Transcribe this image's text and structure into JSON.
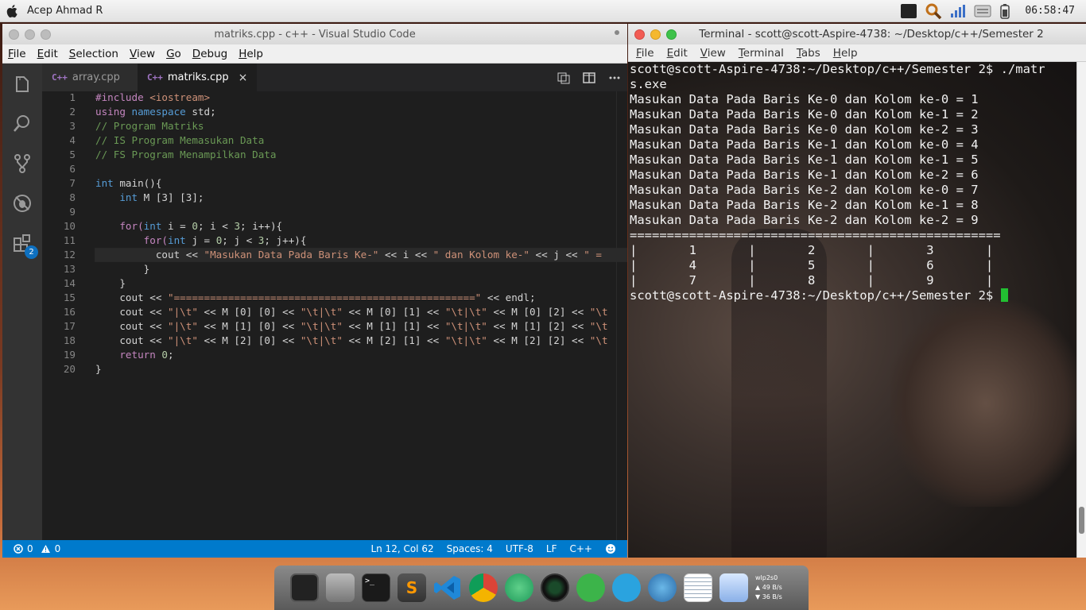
{
  "topbar": {
    "user": "Acep Ahmad R",
    "clock": "06:58:47",
    "tray_icons": [
      "terminal-icon",
      "search-icon",
      "network-monitor-icon",
      "keyboard-icon",
      "battery-icon"
    ]
  },
  "vscode": {
    "title": "matriks.cpp - c++ - Visual Studio Code",
    "menu": [
      {
        "mn": "F",
        "rest": "ile"
      },
      {
        "mn": "E",
        "rest": "dit"
      },
      {
        "mn": "S",
        "rest": "election"
      },
      {
        "mn": "V",
        "rest": "iew"
      },
      {
        "mn": "G",
        "rest": "o"
      },
      {
        "mn": "D",
        "rest": "ebug"
      },
      {
        "mn": "H",
        "rest": "elp"
      }
    ],
    "tabs": [
      {
        "lang": "C++",
        "label": "array.cpp"
      },
      {
        "lang": "C++",
        "label": "matriks.cpp"
      }
    ],
    "tab_close": "×",
    "scm_badge": "2",
    "line_numbers": [
      "1",
      "2",
      "3",
      "4",
      "5",
      "6",
      "7",
      "8",
      "9",
      "10",
      "11",
      "12",
      "13",
      "14",
      "15",
      "16",
      "17",
      "18",
      "19",
      "20"
    ],
    "status": {
      "errors": "0",
      "warnings": "0",
      "position": "Ln 12, Col 62",
      "spaces": "Spaces: 4",
      "encoding": "UTF-8",
      "eol": "LF",
      "language": "C++"
    }
  },
  "code": {
    "l1a": "#include ",
    "l1b": "<iostream>",
    "l2a": "using ",
    "l2b": "namespace ",
    "l2c": "std;",
    "l3": "// Program Matriks",
    "l4": "// IS Program Memasukan Data",
    "l5": "// FS Program Menampilkan Data",
    "l7a": "int ",
    "l7b": "main(){",
    "l8a": "    int ",
    "l8b": "M [3] [3];",
    "l10a": "    for(",
    "l10b": "int ",
    "l10c": "i = ",
    "l10d": "0",
    "l10e": "; i < ",
    "l10f": "3",
    "l10g": "; i++){",
    "l11a": "        for(",
    "l11b": "int ",
    "l11c": "j = ",
    "l11d": "0",
    "l11e": "; j < ",
    "l11f": "3",
    "l11g": "; j++){",
    "l12a": "          cout << ",
    "l12b": "\"Masukan Data Pada Baris Ke-\"",
    "l12c": " << i << ",
    "l12d": "\" dan Kolom ke-\"",
    "l12e": " << j << ",
    "l12f": "\" = ",
    "l13": "        }",
    "l14": "    }",
    "l15a": "    cout << ",
    "l15b": "\"==================================================\"",
    "l15c": " << endl;",
    "l16a": "    cout << ",
    "l16b": "\"|\\t\"",
    "l16c": " << M [0] [0] << ",
    "l16d": "\"\\t|\\t\"",
    "l16e": " << M [0] [1] << ",
    "l16f": "\"\\t|\\t\"",
    "l16g": " << M [0] [2] << ",
    "l16h": "\"\\t",
    "l17a": "    cout << ",
    "l17b": "\"|\\t\"",
    "l17c": " << M [1] [0] << ",
    "l17d": "\"\\t|\\t\"",
    "l17e": " << M [1] [1] << ",
    "l17f": "\"\\t|\\t\"",
    "l17g": " << M [1] [2] << ",
    "l17h": "\"\\t",
    "l18a": "    cout << ",
    "l18b": "\"|\\t\"",
    "l18c": " << M [2] [0] << ",
    "l18d": "\"\\t|\\t\"",
    "l18e": " << M [2] [1] << ",
    "l18f": "\"\\t|\\t\"",
    "l18g": " << M [2] [2] << ",
    "l18h": "\"\\t",
    "l19a": "    return ",
    "l19b": "0",
    "l19c": ";",
    "l20": "}"
  },
  "terminal": {
    "title": "Terminal - scott@scott-Aspire-4738: ~/Desktop/c++/Semester 2",
    "menu": [
      {
        "mn": "F",
        "rest": "ile"
      },
      {
        "mn": "E",
        "rest": "dit"
      },
      {
        "mn": "V",
        "rest": "iew"
      },
      {
        "mn": "T",
        "rest": "erminal"
      },
      {
        "mn": "T",
        "rest": "abs"
      },
      {
        "mn": "H",
        "rest": "elp"
      }
    ],
    "lines": [
      "scott@scott-Aspire-4738:~/Desktop/c++/Semester 2$ ./matr",
      "s.exe",
      "Masukan Data Pada Baris Ke-0 dan Kolom ke-0 = 1",
      "Masukan Data Pada Baris Ke-0 dan Kolom ke-1 = 2",
      "Masukan Data Pada Baris Ke-0 dan Kolom ke-2 = 3",
      "Masukan Data Pada Baris Ke-1 dan Kolom ke-0 = 4",
      "Masukan Data Pada Baris Ke-1 dan Kolom ke-1 = 5",
      "Masukan Data Pada Baris Ke-1 dan Kolom ke-2 = 6",
      "Masukan Data Pada Baris Ke-2 dan Kolom ke-0 = 7",
      "Masukan Data Pada Baris Ke-2 dan Kolom ke-1 = 8",
      "Masukan Data Pada Baris Ke-2 dan Kolom ke-2 = 9",
      "==================================================",
      "|       1       |       2       |       3       |",
      "|       4       |       5       |       6       |",
      "|       7       |       8       |       9       |"
    ],
    "prompt": "scott@scott-Aspire-4738:~/Desktop/c++/Semester 2$ "
  },
  "dock": {
    "items": [
      "workspace-switcher-icon",
      "files-icon",
      "terminal-icon",
      "sublime-text-icon",
      "vscode-icon",
      "chrome-icon",
      "atom-icon",
      "camera-icon",
      "messaging-icon",
      "telegram-icon",
      "browser-icon",
      "text-editor-icon",
      "safari-icon"
    ],
    "net_label": "wlp2s0",
    "net_up": "49 B/s",
    "net_down": "36 B/s"
  },
  "colors": {
    "accent": "#007acc",
    "terminal_cursor": "#22c032"
  }
}
